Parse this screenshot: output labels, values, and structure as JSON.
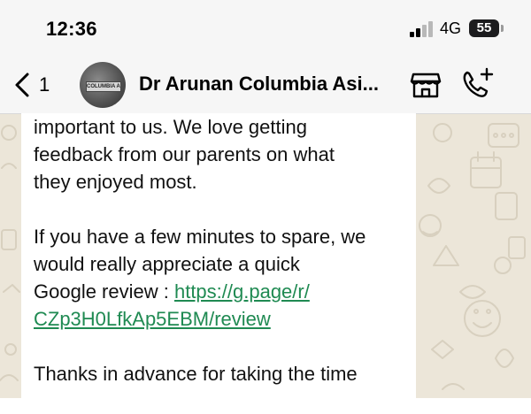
{
  "status_bar": {
    "time": "12:36",
    "network": "4G",
    "battery": "55"
  },
  "header": {
    "back_count": "1",
    "avatar_text": "COLUMBIA ASIA",
    "contact_name": "Dr Arunan Columbia Asi..."
  },
  "message": {
    "line1": "important to us. We love getting",
    "line2": "feedback from our parents on what",
    "line3": "they enjoyed most.",
    "line4": "If you have a few minutes to spare, we",
    "line5": "would really appreciate a quick",
    "line6_prefix": "Google review : ",
    "link_part1": "https://g.page/r/",
    "link_part2": "CZp3H0LfkAp5EBM/review",
    "line8": "Thanks in advance for taking the time"
  },
  "icons": {
    "back": "chevron-left-icon",
    "store": "storefront-icon",
    "call": "add-call-icon",
    "signal": "cellular-signal-icon",
    "battery": "battery-icon"
  },
  "colors": {
    "chat_background": "#ece6d9",
    "link": "#1f8a52",
    "header": "#f6f6f6"
  }
}
